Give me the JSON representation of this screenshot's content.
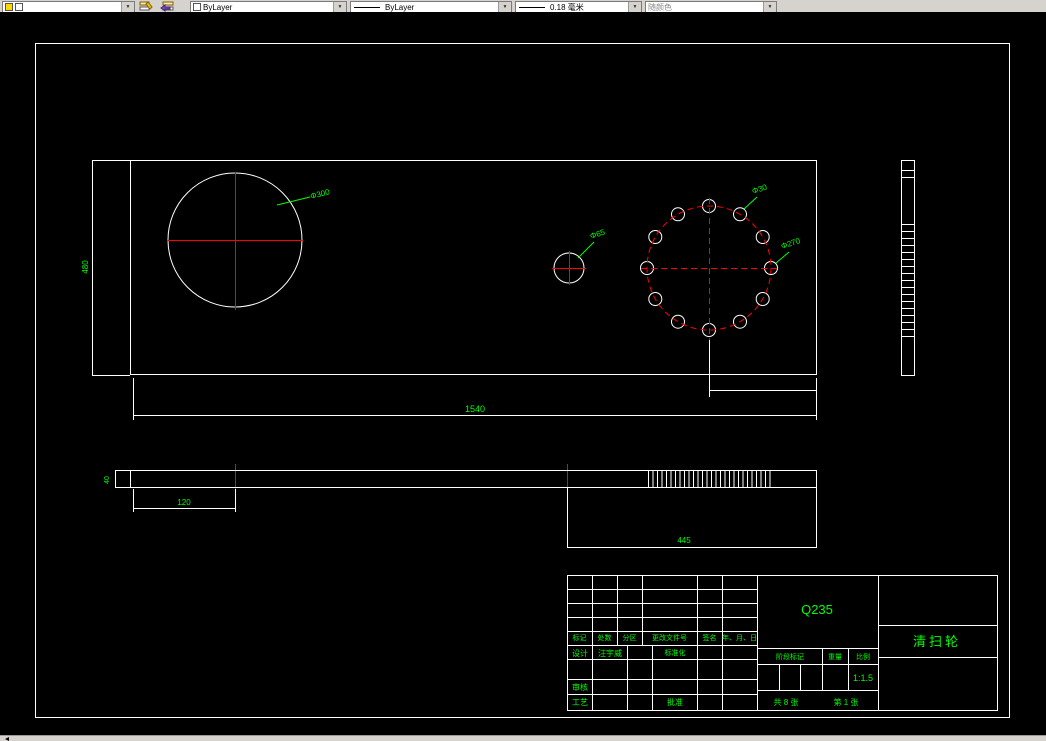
{
  "toolbar": {
    "layer_value": "",
    "color_value": "ByLayer",
    "linetype_value": "ByLayer",
    "lineweight_value": "0.18 毫米",
    "plotstyle_value": "随颜色"
  },
  "drawing": {
    "dims": {
      "overall_length": "1540",
      "plate_height": "480",
      "hub_width": "120",
      "right_section": "445",
      "plate_thickness": "40",
      "big_hole_dia": "Φ300",
      "small_hole_dia": "Φ65",
      "bolt_hole_dia": "Φ30",
      "bolt_circle_dia": "Φ270"
    }
  },
  "title_block": {
    "material": "Q235",
    "part_name": "清扫轮",
    "rev_headers": [
      "标记",
      "处数",
      "分区",
      "更改文件号",
      "签名",
      "年、月、日"
    ],
    "design_label": "设计",
    "designer_name": "汪宇威",
    "standardization_label": "标准化",
    "audit_label": "审核",
    "process_label": "工艺",
    "approve_label": "批准",
    "stage_label": "阶段标记",
    "weight_label": "重量",
    "scale_label": "比例",
    "scale_value": "1:1.5",
    "sheet_total": "共 8 张",
    "sheet_current": "第 1 张"
  },
  "colors": {
    "canvas": "#000000",
    "geometry": "#ffffff",
    "centerline": "#ff0000",
    "annotation": "#00ff00",
    "toolbar": "#d6d3ce"
  }
}
